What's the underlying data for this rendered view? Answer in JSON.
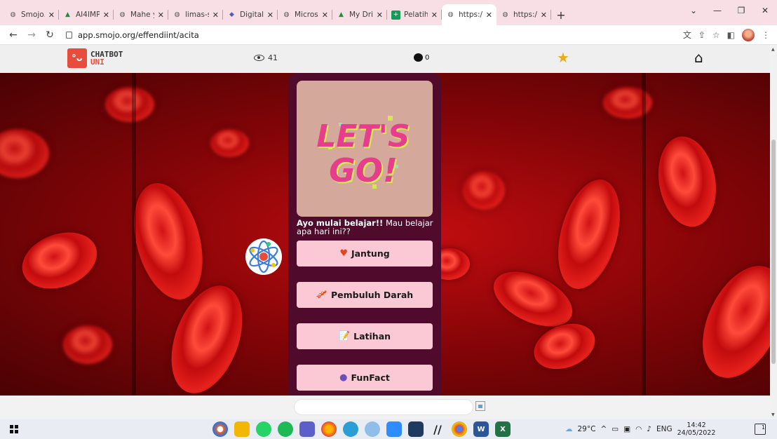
{
  "browser": {
    "tabs": [
      {
        "label": "Smojo.A",
        "icon": "globe-icon",
        "active": false
      },
      {
        "label": "AI4IMPA",
        "icon": "drive-icon",
        "active": false
      },
      {
        "label": "Mahe yo",
        "icon": "globe-icon",
        "active": false
      },
      {
        "label": "limas-se",
        "icon": "globe-icon",
        "active": false
      },
      {
        "label": "Digital T",
        "icon": "shield-icon",
        "active": false
      },
      {
        "label": "Microso",
        "icon": "globe-icon",
        "active": false
      },
      {
        "label": "My Drive",
        "icon": "drive-icon",
        "active": false
      },
      {
        "label": "Pelatiha",
        "icon": "plus-square-icon",
        "active": false
      },
      {
        "label": "https://",
        "icon": "globe-icon",
        "active": true
      },
      {
        "label": "https://",
        "icon": "globe-icon",
        "active": false
      }
    ],
    "new_tab": "+",
    "url": "app.smojo.org/effendiint/acita"
  },
  "site": {
    "logo_line1": "CHATBOT",
    "logo_line2": "UNI",
    "logo_face": "°ᴗ",
    "views_count": "41",
    "comments_count": "0"
  },
  "chat": {
    "hero_text_line1": "LET'S",
    "hero_text_line2": "GO!",
    "message_bold": "Ayo mulai belajar!!",
    "message_rest": " Mau belajar apa hari ini??",
    "options": [
      {
        "icon": "♥",
        "label": "Jantung",
        "icon_color": "#e3431f"
      },
      {
        "icon": "🥓",
        "label": "Pembuluh Darah",
        "icon_color": "#b5521b"
      },
      {
        "icon": "📝",
        "label": "Latihan",
        "icon_color": "#333333"
      },
      {
        "icon": "●",
        "label": "FunFact",
        "icon_color": "#6c4fb6"
      }
    ],
    "input_value": "",
    "input_placeholder": ""
  },
  "taskbar": {
    "temperature": "29°C",
    "language": "ENG",
    "time": "14:42",
    "date": "24/05/2022",
    "notification_count": "1"
  },
  "colors": {
    "card_bg": "#4f0a2c",
    "button_bg": "#fbc9d6",
    "accent": "#e74c3c",
    "star": "#e8ac1c"
  }
}
